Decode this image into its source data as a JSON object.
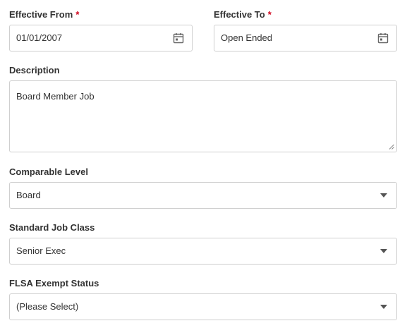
{
  "effective_from": {
    "label": "Effective From",
    "required_mark": "*",
    "value": "01/01/2007",
    "icon": "calendar-icon"
  },
  "effective_to": {
    "label": "Effective To",
    "required_mark": "*",
    "value": "Open Ended",
    "icon": "calendar-icon"
  },
  "description": {
    "label": "Description",
    "value": "Board Member Job"
  },
  "comparable_level": {
    "label": "Comparable Level",
    "selected": "Board",
    "icon": "caret-down-icon"
  },
  "standard_job_class": {
    "label": "Standard Job Class",
    "selected": "Senior Exec",
    "icon": "caret-down-icon"
  },
  "flsa_exempt_status": {
    "label": "FLSA Exempt Status",
    "selected": "(Please Select)",
    "icon": "caret-down-icon"
  },
  "colors": {
    "required": "#d0021b",
    "border": "#cfcfcf",
    "text": "#333333",
    "icon": "#666666"
  }
}
